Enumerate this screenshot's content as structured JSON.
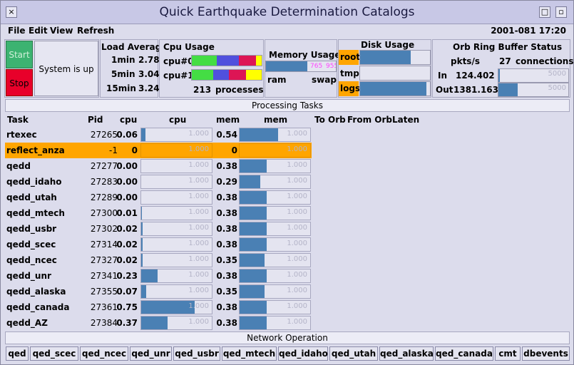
{
  "window": {
    "title": "Quick Earthquake Determination Catalogs",
    "minimize_glyph": "×",
    "maximize_glyph": "□",
    "close_glyph": "▫"
  },
  "menu": {
    "file": "File",
    "edit": "Edit",
    "view": "View",
    "refresh": "Refresh",
    "date": "2001-081 17:20"
  },
  "controls": {
    "start": "Start",
    "stop": "Stop",
    "status": "System is up"
  },
  "load": {
    "title": "Load Average",
    "rows": [
      {
        "label": "1min",
        "value": "2.78"
      },
      {
        "label": "5min",
        "value": "3.04"
      },
      {
        "label": "15min",
        "value": "3.24"
      }
    ]
  },
  "cpu_usage": {
    "title": "Cpu Usage",
    "cpu0": "cpu#0",
    "cpu1": "cpu#1",
    "processes_count": "213",
    "processes_label": "processes"
  },
  "memory": {
    "title": "Memory Usage",
    "ram": "ram",
    "swap": "swap",
    "ram_cap": "765",
    "swap_cap": "955"
  },
  "disk": {
    "title": "Disk Usage",
    "root": "root",
    "tmp": "tmp",
    "logs": "logs",
    "root_fill": 0.72,
    "logs_fill": 0.95
  },
  "orb": {
    "title": "Orb Ring Buffer Status",
    "pkts_label": "pkts/s",
    "connections_count": "27",
    "connections_label": "connections",
    "in_label": "In",
    "in_value": "124.402",
    "out_label": "Out",
    "out_value": "1381.163",
    "in_cap": "5000",
    "out_cap": "5000",
    "in_fill": 0.02,
    "out_fill": 0.28
  },
  "processing": {
    "title": "Processing Tasks",
    "headers": {
      "task": "Task",
      "pid": "Pid",
      "cpu": "cpu",
      "cpu_bar": "cpu",
      "mem": "mem",
      "mem_bar": "mem",
      "to_orb": "To Orb",
      "from_orb": "From Orb",
      "laten": "Laten"
    },
    "bar_cap": "1.000",
    "rows": [
      {
        "task": "rtexec",
        "pid": "27265",
        "cpu": "0.06",
        "mem": "0.54",
        "cpu_v": 0.06,
        "mem_v": 0.54
      },
      {
        "task": "reflect_anza",
        "pid": "-1",
        "cpu": "0",
        "mem": "0",
        "cpu_v": 0,
        "mem_v": 0
      },
      {
        "task": "qedd",
        "pid": "27277",
        "cpu": "0.00",
        "mem": "0.38",
        "cpu_v": 0.0,
        "mem_v": 0.38
      },
      {
        "task": "qedd_idaho",
        "pid": "27283",
        "cpu": "0.00",
        "mem": "0.29",
        "cpu_v": 0.0,
        "mem_v": 0.29
      },
      {
        "task": "qedd_utah",
        "pid": "27289",
        "cpu": "0.00",
        "mem": "0.38",
        "cpu_v": 0.0,
        "mem_v": 0.38
      },
      {
        "task": "qedd_mtech",
        "pid": "27300",
        "cpu": "0.01",
        "mem": "0.38",
        "cpu_v": 0.01,
        "mem_v": 0.38
      },
      {
        "task": "qedd_usbr",
        "pid": "27302",
        "cpu": "0.02",
        "mem": "0.38",
        "cpu_v": 0.02,
        "mem_v": 0.38
      },
      {
        "task": "qedd_scec",
        "pid": "27314",
        "cpu": "0.02",
        "mem": "0.38",
        "cpu_v": 0.02,
        "mem_v": 0.38
      },
      {
        "task": "qedd_ncec",
        "pid": "27327",
        "cpu": "0.02",
        "mem": "0.35",
        "cpu_v": 0.02,
        "mem_v": 0.35
      },
      {
        "task": "qedd_unr",
        "pid": "27341",
        "cpu": "0.23",
        "mem": "0.38",
        "cpu_v": 0.23,
        "mem_v": 0.38
      },
      {
        "task": "qedd_alaska",
        "pid": "27355",
        "cpu": "0.07",
        "mem": "0.35",
        "cpu_v": 0.07,
        "mem_v": 0.35
      },
      {
        "task": "qedd_canada",
        "pid": "27361",
        "cpu": "0.75",
        "mem": "0.38",
        "cpu_v": 0.75,
        "mem_v": 0.38
      },
      {
        "task": "qedd_AZ",
        "pid": "27384",
        "cpu": "0.37",
        "mem": "0.38",
        "cpu_v": 0.37,
        "mem_v": 0.38
      }
    ]
  },
  "network": {
    "title": "Network Operation",
    "buttons": [
      "qed",
      "qed_scec",
      "qed_ncec",
      "qed_unr",
      "qed_usbr",
      "qed_mtech",
      "qed_idaho",
      "qed_utah",
      "qed_alaska",
      "qed_canada",
      "cmt",
      "dbevents"
    ]
  },
  "colors": {
    "highlight": "#ffa500",
    "bar": "#4a80b4",
    "start": "#3cb371",
    "stop": "#e8002a"
  }
}
